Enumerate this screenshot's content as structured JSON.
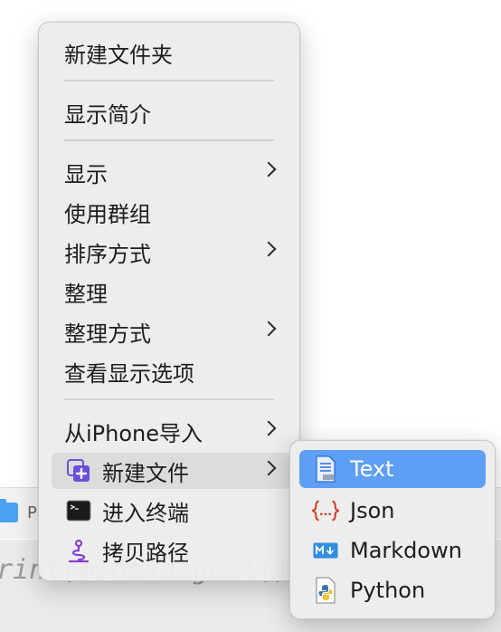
{
  "background": {
    "strip_label": "P",
    "code_text": "rint(m.hexdigest()"
  },
  "menu": {
    "items": {
      "new_folder": "新建文件夹",
      "get_info": "显示简介",
      "show": "显示",
      "use_groups": "使用群组",
      "sort_by": "排序方式",
      "clean_up": "整理",
      "clean_up_by": "整理方式",
      "view_options": "查看显示选项",
      "import_from_iphone": "从iPhone导入",
      "new_file": "新建文件",
      "open_terminal": "进入终端",
      "copy_path": "拷贝路径"
    }
  },
  "submenu": {
    "items": {
      "text": "Text",
      "json": "Json",
      "markdown": "Markdown",
      "python": "Python"
    }
  },
  "colors": {
    "highlight": "#5e9ef5",
    "new_file_icon": "#6b4fd8",
    "copy_path_icon": "#8a3fd1",
    "json_icon": "#d23b2a",
    "markdown_icon": "#2f8fe0"
  }
}
